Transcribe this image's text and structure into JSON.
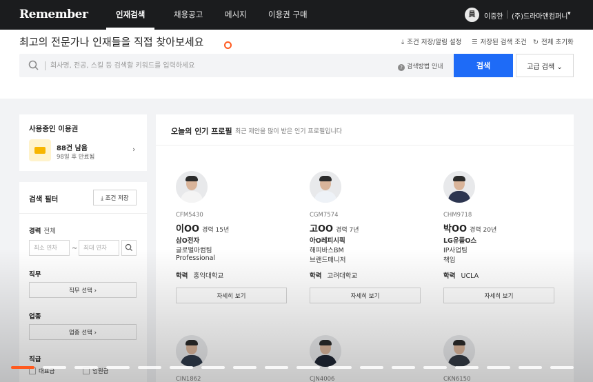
{
  "topbar": {
    "logo": "Remember",
    "nav": [
      "인재검색",
      "채용공고",
      "메시지",
      "이용권 구매"
    ],
    "active_nav": 0,
    "user_avatar": "員",
    "user_name": "이중한",
    "company": "(주)드라마앤컴퍼니",
    "dropdown_icon": "chevron-down-icon"
  },
  "header": {
    "title": "최고의 전문가나 인재들을 직접 찾아보세요",
    "actions": [
      {
        "label": "조건 저장/알림 설정",
        "icon": "download-icon"
      },
      {
        "label": "저장된 검색 조건",
        "icon": "list-icon"
      },
      {
        "label": "전체 초기화",
        "icon": "refresh-icon"
      }
    ]
  },
  "search": {
    "placeholder": "회사명, 전공, 스킬 등 검색할 키워드를 입력하세요",
    "value": "",
    "help_label": "검색방법 안내",
    "button_label": "검색",
    "advanced_label": "고급 검색 ⌄"
  },
  "pass_card": {
    "title": "사용중인 이용권",
    "count": "88건 남음",
    "expire": "98일 후 만료됨"
  },
  "filter": {
    "title": "검색 필터",
    "save_label": "조건 저장",
    "career_label": "경력",
    "career_sub": "전체",
    "min_placeholder": "최소 연차",
    "max_placeholder": "최대 연차",
    "tilde": "~",
    "job_label": "직무",
    "job_select": "직무 선택 ›",
    "industry_label": "업종",
    "industry_select": "업종 선택 ›",
    "rank_label": "직급",
    "rank_options": [
      "대표급",
      "임원급"
    ]
  },
  "popular": {
    "title": "오늘의 인기 프로필",
    "subtitle": "최근 제안을 많이 받은 인기 프로필입니다",
    "edu_label": "학력",
    "detail_label": "자세히 보기",
    "profiles": [
      {
        "code": "CFM5430",
        "name": "이OO",
        "exp": "경력 15년",
        "company": "삼O전자",
        "dept": "글로벌마컴팀",
        "role": "Professional",
        "edu": "홍익대학교",
        "shirt": "#f4f4f4"
      },
      {
        "code": "CGM7574",
        "name": "고OO",
        "exp": "경력 7년",
        "company": "아O레피시픽",
        "dept": "해피바스BM",
        "role": "브랜드매니저",
        "edu": "고려대학교",
        "shirt": "#eef2f7"
      },
      {
        "code": "CHM9718",
        "name": "박OO",
        "exp": "경력 20년",
        "company": "LG유플O스",
        "dept": "IP사업팀",
        "role": "책임",
        "edu": "UCLA",
        "shirt": "#2c3550"
      },
      {
        "code": "CIN1862",
        "shirt": "#2f3a4a"
      },
      {
        "code": "CJN4006",
        "shirt": "#1f2633"
      },
      {
        "code": "CKN6150",
        "shirt": "#333a44"
      }
    ]
  },
  "progress": {
    "segments": 18,
    "active": 0
  }
}
